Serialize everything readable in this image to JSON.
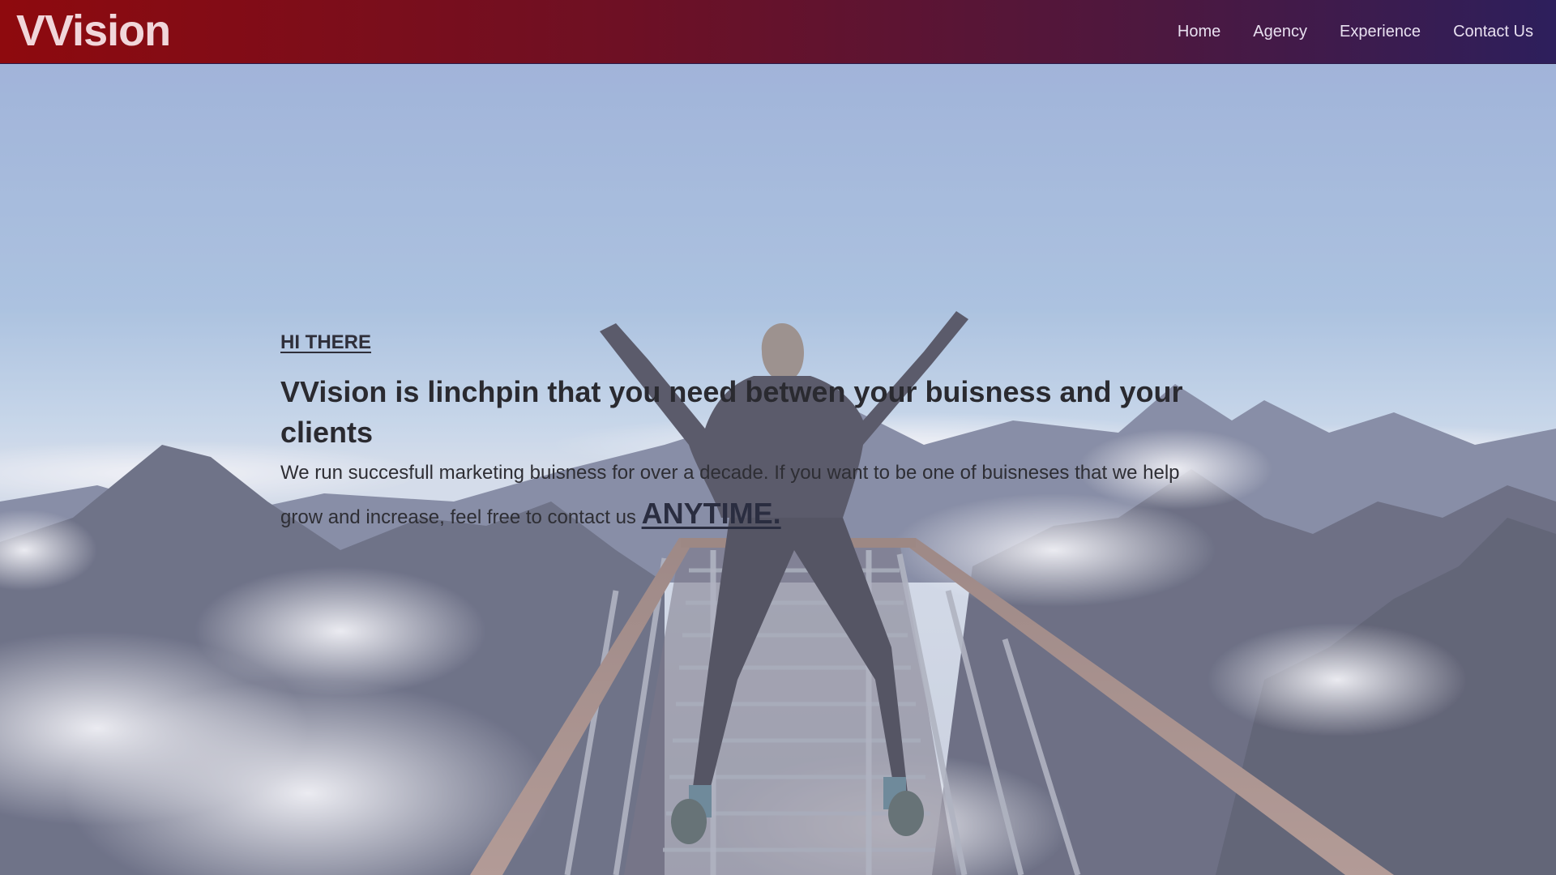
{
  "header": {
    "brand": "VVision",
    "nav": [
      {
        "label": "Home"
      },
      {
        "label": "Agency"
      },
      {
        "label": "Experience"
      },
      {
        "label": "Contact Us"
      }
    ]
  },
  "hero": {
    "eyebrow": "HI THERE",
    "headline": "VVision is linchpin that you need betwen your buisness and your clients",
    "lead": "We run succesfull marketing buisness for over a decade. If you want to be one of buisneses that we help grow and increase, feel free to contact us",
    "cta": "ANYTIME."
  },
  "colors": {
    "header_gradient_start": "#8e0a0e",
    "header_gradient_end": "#2d1f5c",
    "brand_text": "#f1d6da",
    "nav_text": "#e8e0f0",
    "hero_text": "#2a2a30"
  }
}
